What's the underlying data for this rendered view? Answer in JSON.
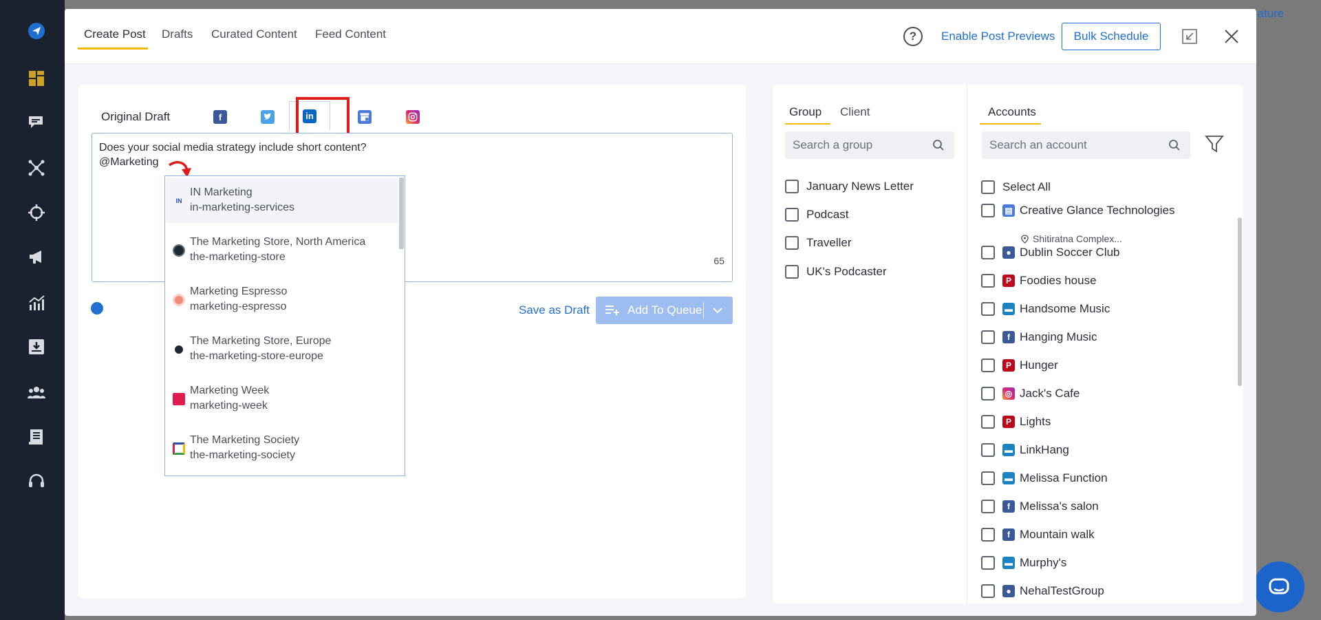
{
  "colors": {
    "accent": "#1f6fd1",
    "tab_underline": "#f5b800",
    "highlight": "#e01b1b",
    "sidebar_bg": "#1a2230"
  },
  "background": {
    "feature_link": "eature"
  },
  "sidebar": {
    "icons": [
      "send-icon",
      "dashboard-icon",
      "chat-icon",
      "network-icon",
      "crosshair-icon",
      "megaphone-icon",
      "analytics-icon",
      "download-icon",
      "team-icon",
      "reports-icon",
      "support-icon"
    ]
  },
  "header": {
    "tabs": [
      {
        "label": "Create Post",
        "active": true
      },
      {
        "label": "Drafts",
        "active": false
      },
      {
        "label": "Curated Content",
        "active": false
      },
      {
        "label": "Feed Content",
        "active": false
      }
    ],
    "help_label": "?",
    "preview_link": "Enable Post Previews",
    "bulk_button": "Bulk Schedule"
  },
  "editor": {
    "original_tab": "Original Draft",
    "network_tabs": [
      "facebook",
      "twitter",
      "linkedin",
      "google-business",
      "instagram"
    ],
    "selected_network": "linkedin",
    "post_line1": "Does your social media strategy include short content?",
    "post_line2": "@Marketing",
    "char_count": "65",
    "save_draft": "Save as Draft",
    "queue_button": "Add To Queue"
  },
  "mention_suggestions": [
    {
      "name": "IN Marketing",
      "slug": "in-marketing-services",
      "logo": "IN"
    },
    {
      "name": "The Marketing Store, North America",
      "slug": "the-marketing-store",
      "logo": ""
    },
    {
      "name": "Marketing Espresso",
      "slug": "marketing-espresso",
      "logo": ""
    },
    {
      "name": "The Marketing Store, Europe",
      "slug": "the-marketing-store-europe",
      "logo": ""
    },
    {
      "name": "Marketing Week",
      "slug": "marketing-week",
      "logo": ""
    },
    {
      "name": "The Marketing Society",
      "slug": "the-marketing-society",
      "logo": ""
    }
  ],
  "groups": {
    "tabs": [
      "Group",
      "Client"
    ],
    "search_placeholder": "Search a group",
    "items": [
      "January News Letter",
      "Podcast",
      "Traveller",
      "UK's Podcaster"
    ]
  },
  "accounts": {
    "tab": "Accounts",
    "search_placeholder": "Search an account",
    "select_all": "Select All",
    "items": [
      {
        "name": "Creative Glance Technologies",
        "network": "google-business",
        "sub": "Shitiratna Complex..."
      },
      {
        "name": "Dublin Soccer Club",
        "network": "facebook-group"
      },
      {
        "name": "Foodies house",
        "network": "pinterest"
      },
      {
        "name": "Handsome Music",
        "network": "linkedin-page"
      },
      {
        "name": "Hanging Music",
        "network": "facebook"
      },
      {
        "name": "Hunger",
        "network": "pinterest"
      },
      {
        "name": "Jack's Cafe",
        "network": "instagram"
      },
      {
        "name": "Lights",
        "network": "pinterest"
      },
      {
        "name": "LinkHang",
        "network": "linkedin-page"
      },
      {
        "name": "Melissa Function",
        "network": "linkedin-page"
      },
      {
        "name": "Melissa's salon",
        "network": "facebook"
      },
      {
        "name": "Mountain walk",
        "network": "facebook"
      },
      {
        "name": "Murphy's",
        "network": "linkedin-page"
      },
      {
        "name": "NehalTestGroup",
        "network": "facebook-group"
      }
    ]
  }
}
